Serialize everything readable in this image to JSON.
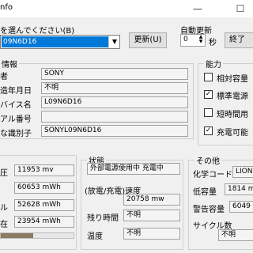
{
  "window": {
    "title": "nfo"
  },
  "header": {
    "select_label": "を選んでください(B)",
    "selected_device": "09N6D16",
    "refresh_button": "更新(U)",
    "auto_update_label": "自動更新",
    "auto_update_value": "0",
    "seconds_unit": "秒",
    "exit_button": "終了"
  },
  "info": {
    "title": "情報",
    "rows": [
      {
        "label": "者",
        "value": "SONY"
      },
      {
        "label": "造年月日",
        "value": "不明"
      },
      {
        "label": "バイス名",
        "value": "L09N6D16"
      },
      {
        "label": "アル番号",
        "value": ""
      },
      {
        "label": "な識別子",
        "value": "SONYL09N6D16"
      }
    ]
  },
  "capability": {
    "title": "能力",
    "items": [
      {
        "label": "相対容量",
        "checked": false
      },
      {
        "label": "標準電源",
        "checked": true
      },
      {
        "label": "短時間用",
        "checked": false
      },
      {
        "label": "充電可能",
        "checked": true
      }
    ]
  },
  "measurements": {
    "rows": [
      {
        "label": "圧",
        "value": "11953 mv"
      },
      {
        "label": "",
        "value": "60653 mWh"
      },
      {
        "label": "ル",
        "value": "52628 mWh"
      },
      {
        "label": "在",
        "value": "23954 mWh"
      }
    ],
    "progress_fraction": 0.45
  },
  "status": {
    "title": "状態",
    "state_value": "外部電源使用中 充電中",
    "rate_label": "(放電/充電)速度",
    "rate_value": "20758 mw",
    "remaining_label": "残り時間",
    "remaining_value": "不明",
    "temp_label": "温度",
    "temp_value": "不明"
  },
  "other": {
    "title": "その他",
    "chem_label": "化学コード",
    "chem_value": "LION",
    "low_cap_label": "低容量",
    "low_cap_value": "1814 m",
    "warn_cap_label": "警告容量",
    "warn_cap_value": "6049",
    "cycle_label": "サイクル数",
    "cycle_value": "不明"
  }
}
